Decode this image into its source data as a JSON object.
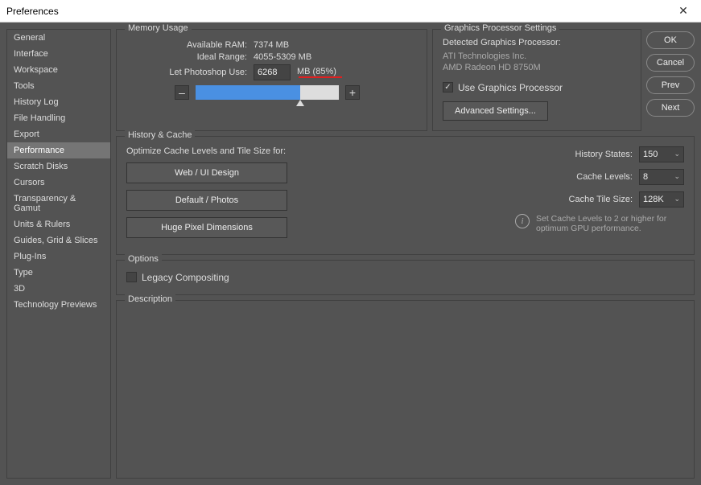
{
  "window": {
    "title": "Preferences",
    "close": "✕"
  },
  "sidebar": {
    "items": [
      "General",
      "Interface",
      "Workspace",
      "Tools",
      "History Log",
      "File Handling",
      "Export",
      "Performance",
      "Scratch Disks",
      "Cursors",
      "Transparency & Gamut",
      "Units & Rulers",
      "Guides, Grid & Slices",
      "Plug-Ins",
      "Type",
      "3D",
      "Technology Previews"
    ],
    "active_index": 7
  },
  "buttons": {
    "ok": "OK",
    "cancel": "Cancel",
    "prev": "Prev",
    "next": "Next"
  },
  "memory": {
    "legend": "Memory Usage",
    "available_label": "Available RAM:",
    "available_value": "7374 MB",
    "ideal_label": "Ideal Range:",
    "ideal_value": "4055-5309 MB",
    "use_label": "Let Photoshop Use:",
    "use_value": "6268",
    "use_unit": "MB (85%)",
    "minus": "–",
    "plus": "+"
  },
  "gpu": {
    "legend": "Graphics Processor Settings",
    "detected_label": "Detected Graphics Processor:",
    "vendor": "ATI Technologies Inc.",
    "device": "AMD Radeon HD 8750M",
    "use_label": "Use Graphics Processor",
    "use_checked": "✓",
    "advanced": "Advanced Settings..."
  },
  "history": {
    "legend": "History & Cache",
    "optimize_label": "Optimize Cache Levels and Tile Size for:",
    "btn_web": "Web / UI Design",
    "btn_default": "Default / Photos",
    "btn_huge": "Huge Pixel Dimensions",
    "states_label": "History States:",
    "states_value": "150",
    "cache_label": "Cache Levels:",
    "cache_value": "8",
    "tile_label": "Cache Tile Size:",
    "tile_value": "128K",
    "hint": "Set Cache Levels to 2 or higher for optimum GPU performance."
  },
  "options": {
    "legend": "Options",
    "legacy_label": "Legacy Compositing"
  },
  "description": {
    "legend": "Description"
  }
}
